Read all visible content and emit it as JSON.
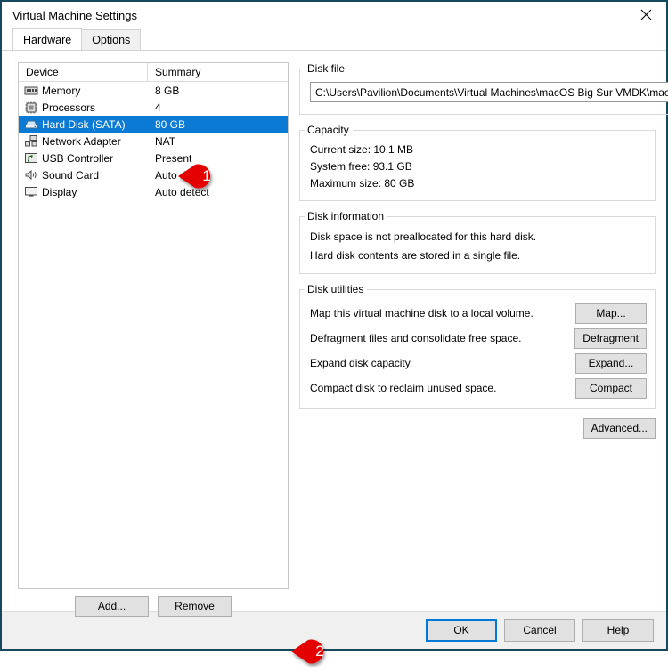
{
  "window": {
    "title": "Virtual Machine Settings",
    "close_icon": "close-icon"
  },
  "tabs": [
    {
      "label": "Hardware",
      "active": true
    },
    {
      "label": "Options",
      "active": false
    }
  ],
  "device_list": {
    "columns": [
      "Device",
      "Summary"
    ],
    "rows": [
      {
        "icon": "memory-icon",
        "name": "Memory",
        "summary": "8 GB",
        "selected": false
      },
      {
        "icon": "processor-icon",
        "name": "Processors",
        "summary": "4",
        "selected": false
      },
      {
        "icon": "hard-disk-icon",
        "name": "Hard Disk (SATA)",
        "summary": "80 GB",
        "selected": true
      },
      {
        "icon": "network-icon",
        "name": "Network Adapter",
        "summary": "NAT",
        "selected": false
      },
      {
        "icon": "usb-icon",
        "name": "USB Controller",
        "summary": "Present",
        "selected": false
      },
      {
        "icon": "sound-card-icon",
        "name": "Sound Card",
        "summary": "Auto detect",
        "selected": false
      },
      {
        "icon": "display-icon",
        "name": "Display",
        "summary": "Auto detect",
        "selected": false
      }
    ],
    "add_label": "Add...",
    "remove_label": "Remove"
  },
  "disk_file": {
    "legend": "Disk file",
    "path": "C:\\Users\\Pavilion\\Documents\\Virtual Machines\\macOS Big Sur VMDK\\macOS I"
  },
  "capacity": {
    "legend": "Capacity",
    "current_size": "Current size: 10.1 MB",
    "system_free": "System free: 93.1 GB",
    "maximum_size": "Maximum size: 80 GB"
  },
  "disk_information": {
    "legend": "Disk information",
    "line1": "Disk space is not preallocated for this hard disk.",
    "line2": "Hard disk contents are stored in a single file."
  },
  "disk_utilities": {
    "legend": "Disk utilities",
    "rows": [
      {
        "label": "Map this virtual machine disk to a local volume.",
        "button": "Map..."
      },
      {
        "label": "Defragment files and consolidate free space.",
        "button": "Defragment"
      },
      {
        "label": "Expand disk capacity.",
        "button": "Expand..."
      },
      {
        "label": "Compact disk to reclaim unused space.",
        "button": "Compact"
      }
    ]
  },
  "advanced_label": "Advanced...",
  "footer": {
    "ok": "OK",
    "cancel": "Cancel",
    "help": "Help"
  },
  "callouts": [
    {
      "number": "1"
    },
    {
      "number": "2"
    }
  ],
  "colors": {
    "window_border": "#15485c",
    "selection_blue": "#0a7ad4",
    "callout_red": "#e50000",
    "focus_blue": "#0078d7",
    "button_face": "#e1e1e1",
    "bottom_bar": "#f0f0f0"
  }
}
